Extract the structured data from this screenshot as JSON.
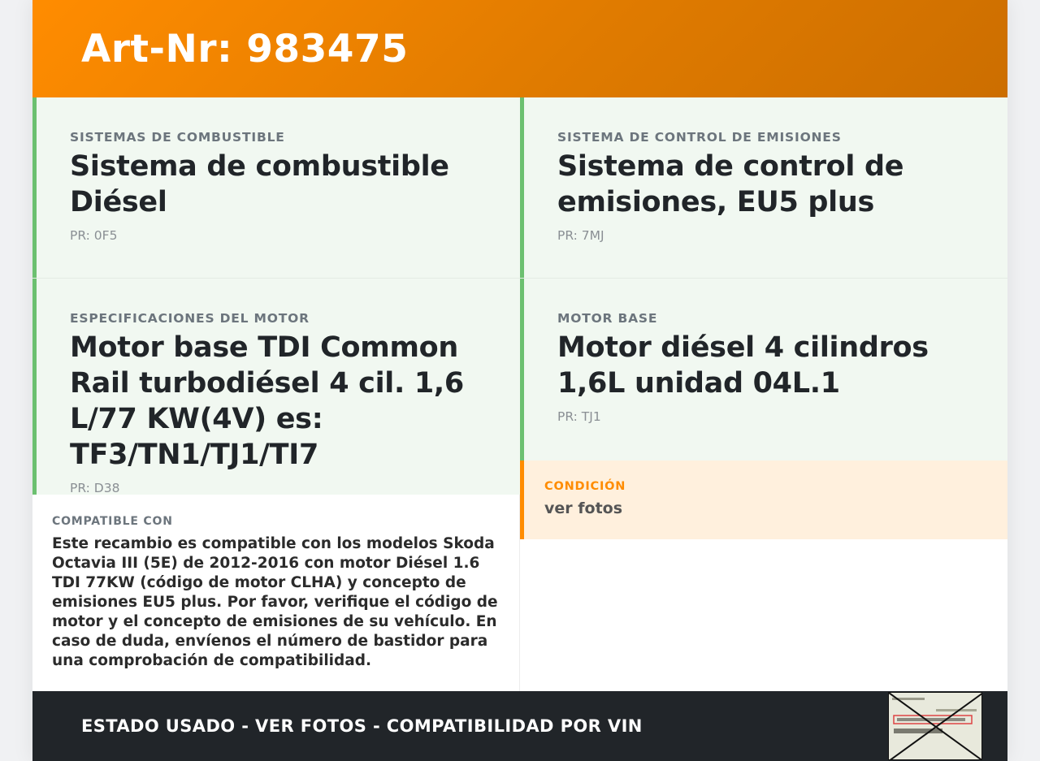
{
  "header": {
    "title": "Art-Nr: 983475"
  },
  "cards": [
    {
      "label": "SISTEMAS DE COMBUSTIBLE",
      "title": "Sistema de combustible Diésel",
      "pr": "PR: 0F5"
    },
    {
      "label": "SISTEMA DE CONTROL DE EMISIONES",
      "title": "Sistema de control de emisiones, EU5 plus",
      "pr": "PR: 7MJ"
    },
    {
      "label": "ESPECIFICACIONES DEL MOTOR",
      "title": "Motor base TDI Common Rail turbodiésel 4 cil. 1,6 L/77 KW(4V) es: TF3/TN1/TJ1/TI7",
      "pr": "PR: D38"
    },
    {
      "label": "MOTOR BASE",
      "title": "Motor diésel 4 cilindros 1,6L unidad 04L.1",
      "pr": "PR: TJ1"
    }
  ],
  "condition": {
    "label": "CONDICIÓN",
    "value": "ver fotos"
  },
  "compat": {
    "label": "COMPATIBLE CON",
    "text": "Este recambio es compatible con los modelos Skoda Octavia III (5E) de 2012-2016 con motor Diésel 1.6 TDI 77KW (código de motor CLHA) y concepto de emisiones EU5 plus. Por favor, verifique el código de motor y el concepto de emisiones de su vehículo. En caso de duda, envíenos el número de bastidor para una comprobación de compatibilidad."
  },
  "footer": {
    "text": "ESTADO USADO - VER FOTOS - COMPATIBILIDAD POR VIN"
  },
  "colors": {
    "accent": "#ff8c00",
    "card_border": "#6cc070",
    "footer_bg": "#212529"
  }
}
